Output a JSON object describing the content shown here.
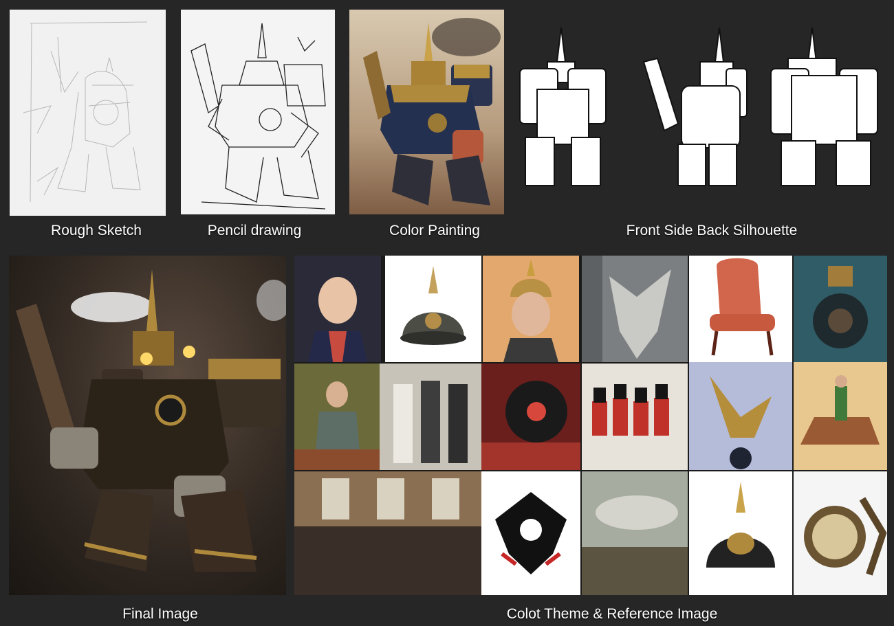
{
  "captions": {
    "rough_sketch": "Rough Sketch",
    "pencil_drawing": "Pencil drawing",
    "color_painting": "Color Painting",
    "silhouette": "Front Side Back Silhouette",
    "final_image": "Final Image",
    "reference": "Colot Theme & Reference Image"
  },
  "colors": {
    "background": "#262626",
    "caption": "#ffffff",
    "brass": "#b08a3c",
    "navy": "#2a3350",
    "paper": "#f2f2f2"
  },
  "reference_grid": {
    "rows": 3,
    "columns": 6,
    "tiles": [
      "kaiser-portrait",
      "pickelhaube-helmet",
      "bismarck-portrait",
      "stone-eagle",
      "red-armchair",
      "steam-engine-cab",
      "seated-officer-portrait",
      "three-officers-photo",
      "red-locomotive",
      "redcoat-soldiers",
      "golden-eagle-statue",
      "cavalry-rider",
      "hall-of-mirrors-painting",
      "imperial-eagle-crest",
      "battle-painting",
      "brass-pickelhaube",
      "brass-pocket-watch"
    ]
  }
}
